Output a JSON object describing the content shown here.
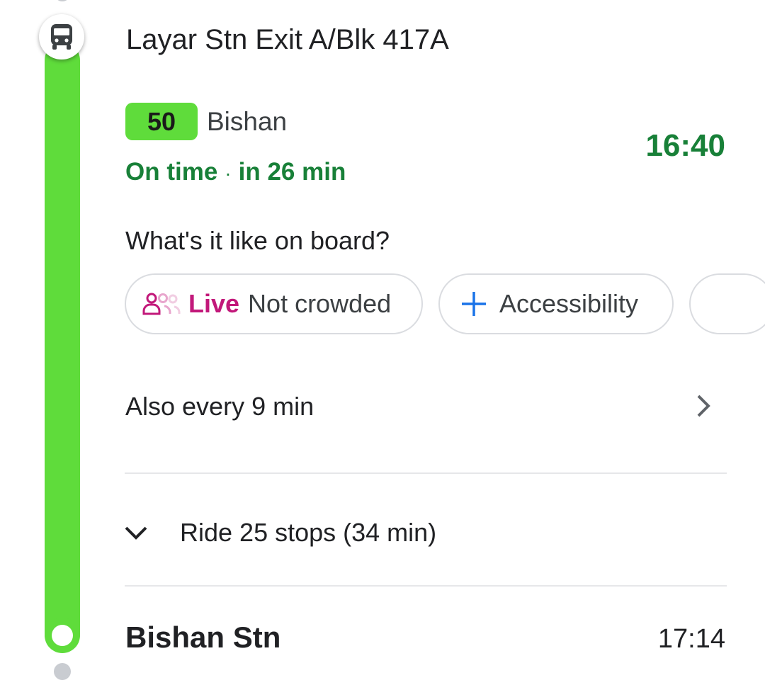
{
  "stop": {
    "name": "Layar Stn Exit A/Blk 417A"
  },
  "bus": {
    "route_number": "50",
    "destination": "Bishan",
    "status": "On time",
    "separator": "·",
    "eta": "in 26 min",
    "departure_time": "16:40",
    "route_color": "#5fdc3b"
  },
  "onboard": {
    "question": "What's it like on board?",
    "chips": {
      "crowd": {
        "icon": "people-icon",
        "live_label": "Live",
        "label": "Not crowded"
      },
      "accessibility": {
        "icon": "plus-icon",
        "label": "Accessibility"
      }
    }
  },
  "frequency": {
    "label": "Also every 9 min",
    "icon": "chevron-right-icon"
  },
  "ride": {
    "label": "Ride 25 stops (34 min)",
    "icon": "chevron-down-icon"
  },
  "destination_stop": {
    "name": "Bishan Stn",
    "arrival_time": "17:14"
  },
  "colors": {
    "status_green": "#188038",
    "live_magenta": "#c2187a",
    "accent_blue": "#1a73e8"
  }
}
